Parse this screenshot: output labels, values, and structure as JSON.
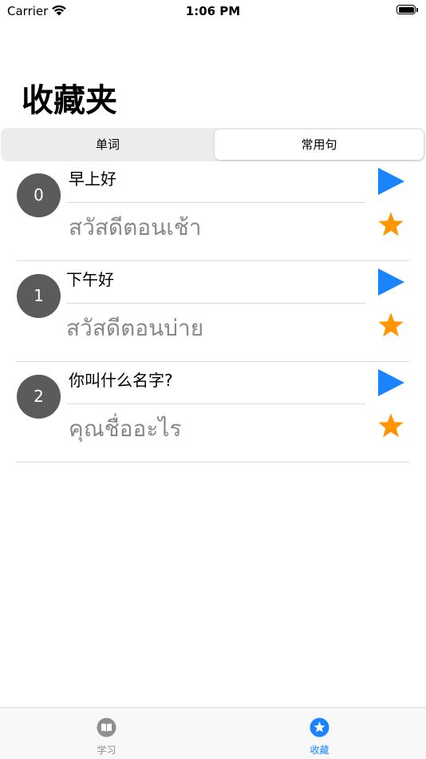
{
  "status_bar": {
    "carrier": "Carrier",
    "time": "1:06 PM"
  },
  "page": {
    "title": "收藏夹"
  },
  "segments": [
    "单词",
    "常用句"
  ],
  "selected_segment": "常用句",
  "items": [
    {
      "index": "0",
      "phrase": "早上好",
      "translation": "สวัสดีตอนเช้า"
    },
    {
      "index": "1",
      "phrase": "下午好",
      "translation": "สวัสดีตอนบ่าย"
    },
    {
      "index": "2",
      "phrase": "你叫什么名字?",
      "translation": "คุณชื่ออะไร"
    }
  ],
  "tab_bar": {
    "tabs": [
      {
        "label": "学习",
        "icon": "book-icon"
      },
      {
        "label": "收藏",
        "icon": "star-circle-icon"
      }
    ],
    "selected": "收藏"
  },
  "colors": {
    "accent": "#1a84ff",
    "star": "#ff9500",
    "badge": "#5b5b5b",
    "translation_text": "#888888",
    "inactive_tab": "#8e8e93"
  }
}
